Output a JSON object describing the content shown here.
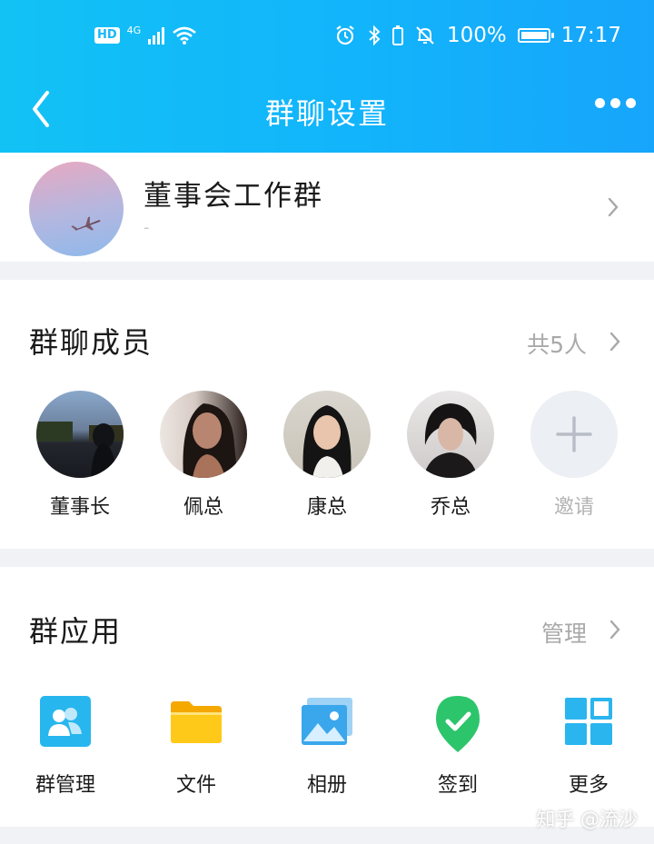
{
  "status_bar": {
    "hd": "HD",
    "network": "4G",
    "battery_percent": "100%",
    "time": "17:17"
  },
  "navbar": {
    "title": "群聊设置"
  },
  "group": {
    "name": "董事会工作群",
    "subtitle": "-"
  },
  "members": {
    "title": "群聊成员",
    "count_text": "共5人",
    "list": [
      {
        "name": "董事长"
      },
      {
        "name": "佩总"
      },
      {
        "name": "康总"
      },
      {
        "name": "乔总"
      }
    ],
    "invite_label": "邀请"
  },
  "apps": {
    "title": "群应用",
    "manage_label": "管理",
    "items": [
      {
        "label": "群管理",
        "icon": "group-manage-icon"
      },
      {
        "label": "文件",
        "icon": "folder-icon"
      },
      {
        "label": "相册",
        "icon": "album-icon"
      },
      {
        "label": "签到",
        "icon": "check-in-icon"
      },
      {
        "label": "更多",
        "icon": "more-grid-icon"
      }
    ]
  },
  "watermark": "知乎 @流沙",
  "colors": {
    "header": "#12b4fb",
    "accent": "#22a4f0",
    "check_in": "#2dc66b",
    "folder": "#ffc600"
  }
}
